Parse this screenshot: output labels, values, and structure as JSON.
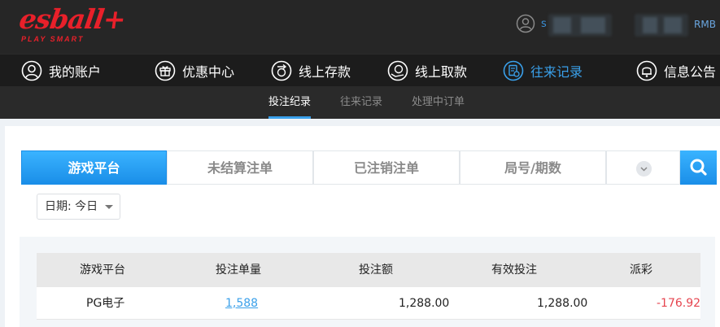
{
  "header": {
    "logo_text": "esball+",
    "logo_subtext": "PLAY SMART",
    "user_prefix": "s",
    "currency": "RMB"
  },
  "nav": {
    "items": [
      {
        "label": "我的账户",
        "icon": "user-icon"
      },
      {
        "label": "优惠中心",
        "icon": "gift-icon"
      },
      {
        "label": "线上存款",
        "icon": "deposit-icon"
      },
      {
        "label": "线上取款",
        "icon": "withdraw-icon"
      },
      {
        "label": "往来记录",
        "icon": "records-icon",
        "active": true
      },
      {
        "label": "信息公告",
        "icon": "bell-icon"
      }
    ],
    "active_color": "#3aa0ea"
  },
  "subnav": {
    "items": [
      {
        "label": "投注纪录",
        "active": true
      },
      {
        "label": "往来记录"
      },
      {
        "label": "处理中订单"
      }
    ]
  },
  "tabs": {
    "items": [
      {
        "label": "游戏平台",
        "active": true
      },
      {
        "label": "未结算注单"
      },
      {
        "label": "已注销注单"
      },
      {
        "label": "局号/期数"
      }
    ],
    "more_icon": "chevron-down-icon",
    "search_icon": "search-icon"
  },
  "filter": {
    "date_label": "日期: 今日"
  },
  "table": {
    "headers": [
      "游戏平台",
      "投注单量",
      "投注额",
      "有效投注",
      "派彩"
    ],
    "rows": [
      {
        "platform": "PG电子",
        "count": "1,588",
        "amount": "1,288.00",
        "valid": "1,288.00",
        "payout": "-176.92"
      }
    ]
  },
  "colors": {
    "brand_red": "#e8202a",
    "accent_blue": "#3aa0ea",
    "negative_red": "#e6454f"
  }
}
